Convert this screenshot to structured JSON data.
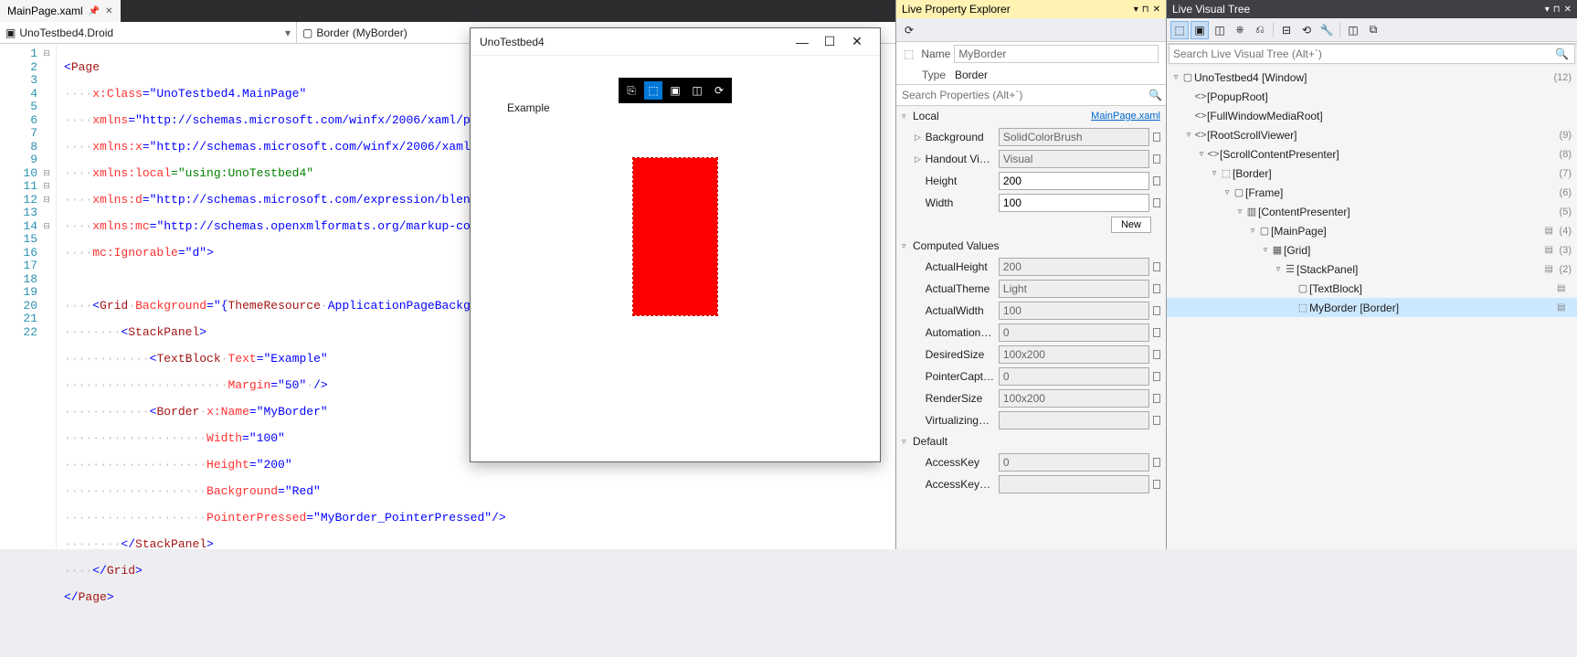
{
  "tabs": {
    "doc_name": "MainPage.xaml"
  },
  "navbar": {
    "left": "UnoTestbed4.Droid",
    "right": "Border (MyBorder)"
  },
  "code": {
    "lines": [
      "1",
      "2",
      "3",
      "4",
      "5",
      "6",
      "7",
      "8",
      "9",
      "10",
      "11",
      "12",
      "13",
      "14",
      "15",
      "16",
      "17",
      "18",
      "19",
      "20",
      "21",
      "22"
    ]
  },
  "appwin": {
    "title": "UnoTestbed4",
    "example": "Example"
  },
  "lpe": {
    "title": "Live Property Explorer",
    "name_label": "Name",
    "name_value": "MyBorder",
    "type_label": "Type",
    "type_value": "Border",
    "search_placeholder": "Search Properties (Alt+`)",
    "local_group": "Local",
    "local_source": "MainPage.xaml",
    "props_local": [
      {
        "name": "Background",
        "value": "SolidColorBrush",
        "exp": "▷",
        "ro": true
      },
      {
        "name": "Handout Visual",
        "value": "Visual",
        "exp": "▷",
        "ro": true
      },
      {
        "name": "Height",
        "value": "200",
        "exp": "",
        "ro": false
      },
      {
        "name": "Width",
        "value": "100",
        "exp": "",
        "ro": false
      }
    ],
    "new_btn": "New",
    "computed_group": "Computed Values",
    "props_computed": [
      {
        "name": "ActualHeight",
        "value": "200"
      },
      {
        "name": "ActualTheme",
        "value": "Light",
        "dropdown": true
      },
      {
        "name": "ActualWidth",
        "value": "100"
      },
      {
        "name": "AutomationPrope...",
        "value": "0"
      },
      {
        "name": "DesiredSize",
        "value": "100x200"
      },
      {
        "name": "PointerCaptures",
        "value": "0"
      },
      {
        "name": "RenderSize",
        "value": "100x200"
      },
      {
        "name": "VirtualizingStackP...",
        "value": ""
      }
    ],
    "default_group": "Default",
    "props_default": [
      {
        "name": "AccessKey",
        "value": "0"
      },
      {
        "name": "AccessKeyScope",
        "value": ""
      }
    ]
  },
  "lvt": {
    "title": "Live Visual Tree",
    "search_placeholder": "Search Live Visual Tree (Alt+`)",
    "nodes": [
      {
        "indent": 0,
        "exp": "▿",
        "ic": "▢",
        "name": "UnoTestbed4 [Window]",
        "cnt": "(12)"
      },
      {
        "indent": 1,
        "exp": "",
        "ic": "<>",
        "name": "[PopupRoot]",
        "cnt": ""
      },
      {
        "indent": 1,
        "exp": "",
        "ic": "<>",
        "name": "[FullWindowMediaRoot]",
        "cnt": ""
      },
      {
        "indent": 1,
        "exp": "▿",
        "ic": "<>",
        "name": "[RootScrollViewer]",
        "cnt": "(9)"
      },
      {
        "indent": 2,
        "exp": "▿",
        "ic": "<>",
        "name": "[ScrollContentPresenter]",
        "cnt": "(8)"
      },
      {
        "indent": 3,
        "exp": "▿",
        "ic": "⬚",
        "name": "[Border]",
        "cnt": "(7)"
      },
      {
        "indent": 4,
        "exp": "▿",
        "ic": "▢",
        "name": "[Frame]",
        "cnt": "(6)"
      },
      {
        "indent": 5,
        "exp": "▿",
        "ic": "▥",
        "name": "[ContentPresenter]",
        "cnt": "(5)"
      },
      {
        "indent": 6,
        "exp": "▿",
        "ic": "▢",
        "name": "[MainPage]",
        "cnt": "(4)",
        "src": "▤"
      },
      {
        "indent": 7,
        "exp": "▿",
        "ic": "▦",
        "name": "[Grid]",
        "cnt": "(3)",
        "src": "▤"
      },
      {
        "indent": 8,
        "exp": "▿",
        "ic": "☰",
        "name": "[StackPanel]",
        "cnt": "(2)",
        "src": "▤"
      },
      {
        "indent": 9,
        "exp": "",
        "ic": "▢",
        "name": "[TextBlock]",
        "cnt": "",
        "src": "▤"
      },
      {
        "indent": 9,
        "exp": "",
        "ic": "⬚",
        "name": "MyBorder [Border]",
        "cnt": "",
        "src": "▤",
        "selected": true
      }
    ]
  }
}
